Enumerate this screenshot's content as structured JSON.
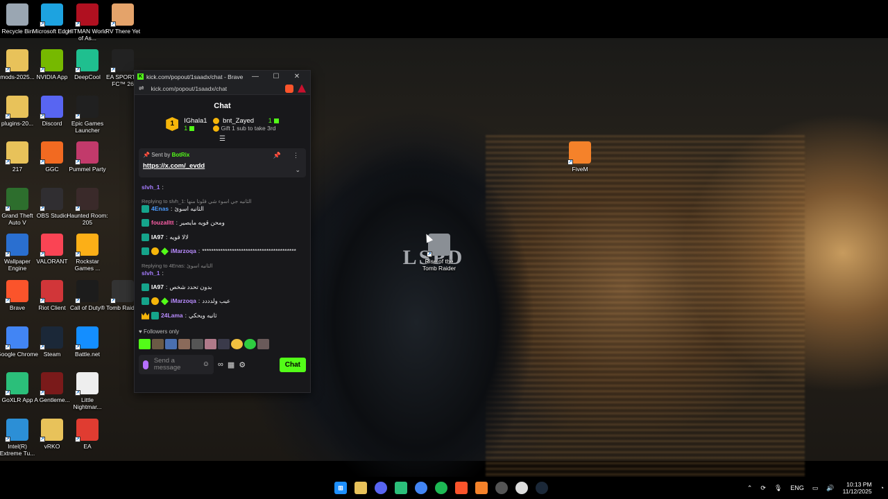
{
  "desktop_icons": [
    {
      "label": "Recycle Bin",
      "icon": "recycle-bin-icon",
      "color": "#9aa6b2"
    },
    {
      "label": "Microsoft Edge",
      "icon": "edge-icon",
      "color": "#1da3e0"
    },
    {
      "label": "HITMAN World of As...",
      "icon": "hitman-icon",
      "color": "#b01020"
    },
    {
      "label": "RV There Yet",
      "icon": "rv-there-yet-icon",
      "color": "#e4a36a"
    },
    {
      "label": "mods-2025...",
      "icon": "folder-icon",
      "color": "#e8c25a"
    },
    {
      "label": "NVIDIA App",
      "icon": "nvidia-icon",
      "color": "#76b900"
    },
    {
      "label": "DeepCool",
      "icon": "deepcool-icon",
      "color": "#1fbf8f"
    },
    {
      "label": "EA SPORTS FC™ 26",
      "icon": "ea-fc-icon",
      "color": "#222222"
    },
    {
      "label": "plugins-20...",
      "icon": "folder-icon",
      "color": "#e8c25a"
    },
    {
      "label": "Discord",
      "icon": "discord-icon",
      "color": "#5865f2"
    },
    {
      "label": "Epic Games Launcher",
      "icon": "epic-games-icon",
      "color": "#202020"
    },
    {
      "label": "217",
      "icon": "folder-icon",
      "color": "#e8c25a"
    },
    {
      "label": "GGC",
      "icon": "ggc-icon",
      "color": "#f26a21"
    },
    {
      "label": "Pummel Party",
      "icon": "pummel-party-icon",
      "color": "#c23a6b"
    },
    {
      "label": "Grand Theft Auto V",
      "icon": "gta-v-icon",
      "color": "#2d6e2d"
    },
    {
      "label": "OBS Studio",
      "icon": "obs-icon",
      "color": "#302e31"
    },
    {
      "label": "Haunted Room: 205",
      "icon": "haunted-room-icon",
      "color": "#3a2a2a"
    },
    {
      "label": "Wallpaper Engine",
      "icon": "wallpaper-engine-icon",
      "color": "#2a6fd0"
    },
    {
      "label": "VALORANT",
      "icon": "valorant-icon",
      "color": "#fa4454"
    },
    {
      "label": "Rockstar Games ...",
      "icon": "rockstar-icon",
      "color": "#fcaf17"
    },
    {
      "label": "Brave",
      "icon": "brave-icon",
      "color": "#fb542b"
    },
    {
      "label": "Riot Client",
      "icon": "riot-icon",
      "color": "#d13639"
    },
    {
      "label": "Call of Duty®",
      "icon": "call-of-duty-icon",
      "color": "#1c1c1c"
    },
    {
      "label": "Tomb Raid...",
      "icon": "tomb-raider-icon",
      "color": "#333333"
    },
    {
      "label": "Google Chrome",
      "icon": "chrome-icon",
      "color": "#4285f4"
    },
    {
      "label": "Steam",
      "icon": "steam-icon",
      "color": "#1b2838"
    },
    {
      "label": "Battle.net",
      "icon": "battlenet-icon",
      "color": "#148eff"
    },
    {
      "label": "GoXLR App",
      "icon": "goxlr-icon",
      "color": "#2bbf7a"
    },
    {
      "label": "A Gentleme...",
      "icon": "gentleman-icon",
      "color": "#7a1a1a"
    },
    {
      "label": "Little Nightmar...",
      "icon": "little-nightmares-icon",
      "color": "#eeeeee"
    },
    {
      "label": "Intel(R) Extreme Tu...",
      "icon": "intel-xtu-icon",
      "color": "#2c8fd6"
    },
    {
      "label": "vRKO",
      "icon": "folder-icon",
      "color": "#e8c25a"
    },
    {
      "label": "EA",
      "icon": "ea-icon",
      "color": "#e03c31"
    },
    {
      "label": "FiveM",
      "icon": "fivem-icon",
      "color": "#f5822a"
    },
    {
      "label": "Rise of the Tomb Raider",
      "icon": "rise-tomb-raider-icon",
      "color": "#8a8f95"
    }
  ],
  "wallpaper": {
    "vest_text": "LSPD"
  },
  "browser": {
    "title": "kick.com/popout/1saadx/chat - Brave",
    "url": "kick.com/popout/1saadx/chat",
    "min": "—",
    "max": "☐",
    "close": "✕"
  },
  "chat": {
    "header": "Chat",
    "leaderboard": {
      "rank": "1",
      "first_name": "IGhala1",
      "first_count": "1",
      "second_name": "bnt_Zayed",
      "second_count": "1",
      "gift_text": "Gift 1 sub to take 3rd"
    },
    "pinned": {
      "sent_by_prefix": "Sent by",
      "sent_by": "BotRix",
      "link": "https://x.com/_evdd"
    },
    "messages": [
      {
        "reply": "",
        "user": "slvh_1",
        "user_color": "#a67cff",
        "text": ""
      },
      {
        "reply": "Replying to slvh_1: الثانيه جي اسوء شي قلوتا منها",
        "user": "4Enas",
        "user_color": "#4b9cff",
        "text": "الثانيه اسوئ"
      },
      {
        "reply": "",
        "user": "fouzalltt",
        "user_color": "#ff5fa8",
        "text": "ومحن قويه مايصير"
      },
      {
        "reply": "",
        "user": "IA97",
        "user_color": "#ffffff",
        "text": "لالا قويه"
      },
      {
        "reply": "",
        "user": "iMarzoqa",
        "user_color": "#b98cff",
        "text": "*****************************************"
      },
      {
        "reply": "Replying to 4Enas: الثانيه اسوئ",
        "user": "slvh_1",
        "user_color": "#a67cff",
        "text": ""
      },
      {
        "reply": "",
        "user": "IA97",
        "user_color": "#ffffff",
        "text": "بدون تحدد شخص"
      },
      {
        "reply": "",
        "user": "iMarzoqa",
        "user_color": "#b98cff",
        "text": "عيب ولدددد"
      },
      {
        "reply": "",
        "user": "24Lama",
        "user_color": "#b98cff",
        "text": "ثانيه ويحكي"
      }
    ],
    "followers_only": "Followers only",
    "input_placeholder": "Send a message",
    "send_label": "Chat"
  },
  "taskbar": {
    "lang": "ENG",
    "time": "10:13 PM",
    "date": "11/12/2025"
  }
}
